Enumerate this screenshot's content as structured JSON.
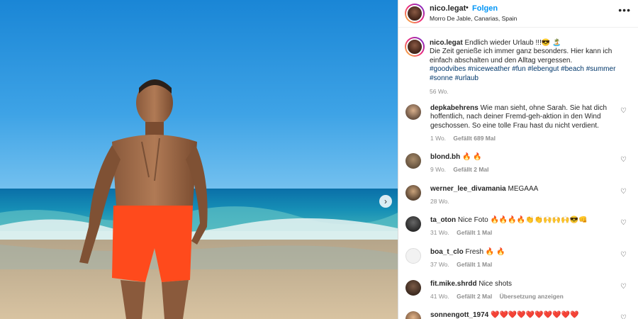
{
  "post": {
    "username": "nico.legat",
    "separator": "•",
    "follow_label": "Folgen",
    "location": "Morro De Jable, Canarias, Spain",
    "more_label": "•••",
    "caption_text": "Endlich wieder Urlaub !!!😎 🏝️",
    "caption_line2": "Die Zeit genieße ich immer ganz besonders. Hier kann ich einfach abschalten und den Alltag vergessen.",
    "hashtags": "#goodvibes #niceweather #fun #lebengut #beach #summer #sonne #urlaub",
    "age": "56 Wo."
  },
  "photo_nav": {
    "next_label": "›"
  },
  "comments": [
    {
      "user": "depkabehrens",
      "text": "Wie man sieht, ohne Sarah. Sie hat dich hoffentlich, nach deiner Fremd-geh-aktion in den Wind geschossen. So eine tolle Frau hast du nicht verdient.",
      "age": "1 Wo.",
      "likes": "Gefällt 689 Mal",
      "extra": ""
    },
    {
      "user": "blond.bh",
      "text": "🔥 🔥",
      "age": "9 Wo.",
      "likes": "Gefällt 2 Mal",
      "extra": ""
    },
    {
      "user": "werner_lee_divamania",
      "text": "MEGAAA",
      "age": "28 Wo.",
      "likes": "",
      "extra": ""
    },
    {
      "user": "ta_oton",
      "text": "Nice Foto 🔥🔥🔥🔥👏👏🙌🙌🙌😎👊",
      "age": "31 Wo.",
      "likes": "Gefällt 1 Mal",
      "extra": ""
    },
    {
      "user": "boa_t_clo",
      "text": "Fresh 🔥 🔥",
      "age": "37 Wo.",
      "likes": "Gefällt 1 Mal",
      "extra": ""
    },
    {
      "user": "fit.mike.shrdd",
      "text": "Nice shots",
      "age": "41 Wo.",
      "likes": "Gefällt 2 Mal",
      "extra": "Übersetzung anzeigen"
    },
    {
      "user": "sonnengott_1974",
      "text": "❤️❤️❤️❤️❤️❤️❤️❤️❤️❤️",
      "age": "",
      "likes": "",
      "extra": ""
    }
  ],
  "icons": {
    "heart": "heart-icon",
    "more": "more-options-icon",
    "next": "chevron-right-icon"
  },
  "colors": {
    "link_blue": "#0095f6",
    "hashtag": "#00376b",
    "muted": "#8e8e8e"
  }
}
